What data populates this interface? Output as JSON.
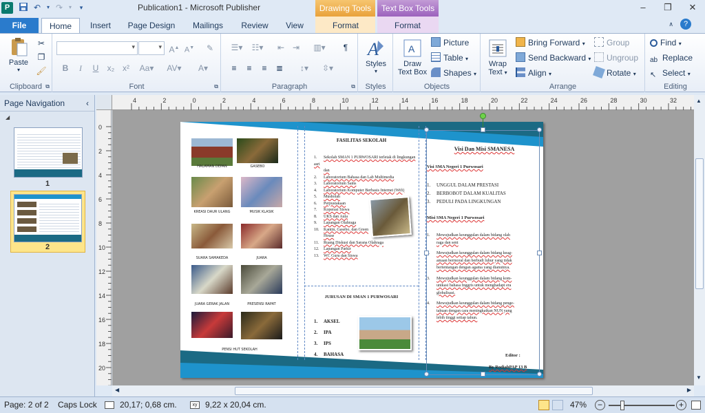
{
  "titlebar": {
    "app_icon": "P",
    "title": "Publication1 - Microsoft Publisher",
    "drawing_tools": "Drawing Tools",
    "text_box_tools": "Text Box Tools",
    "qat_icons": [
      "save-icon",
      "undo-icon",
      "redo-icon",
      "customize-icon"
    ],
    "window_buttons": [
      "minimize-icon",
      "restore-icon",
      "close-icon"
    ]
  },
  "tabs": {
    "file": "File",
    "home": "Home",
    "insert": "Insert",
    "page_design": "Page Design",
    "mailings": "Mailings",
    "review": "Review",
    "view": "View",
    "format_drawing": "Format",
    "format_textbox": "Format"
  },
  "ribbon": {
    "clipboard": {
      "label": "Clipboard",
      "paste": "Paste"
    },
    "font": {
      "label": "Font",
      "font_name": "",
      "font_size": ""
    },
    "paragraph": {
      "label": "Paragraph"
    },
    "styles": {
      "label": "Styles",
      "styles_btn": "Styles"
    },
    "objects": {
      "label": "Objects",
      "draw_text_box_1": "Draw",
      "draw_text_box_2": "Text Box",
      "picture": "Picture",
      "table": "Table",
      "shapes": "Shapes"
    },
    "arrange": {
      "label": "Arrange",
      "wrap_text_1": "Wrap",
      "wrap_text_2": "Text",
      "bring_forward": "Bring Forward",
      "send_backward": "Send Backward",
      "align": "Align",
      "group": "Group",
      "ungroup": "Ungroup",
      "rotate": "Rotate"
    },
    "editing": {
      "label": "Editing",
      "find": "Find",
      "replace": "Replace",
      "select": "Select"
    }
  },
  "nav": {
    "title": "Page Navigation",
    "pages": [
      {
        "num": "1"
      },
      {
        "num": "2",
        "selected": true
      }
    ]
  },
  "ruler": {
    "h_labels": [
      "4",
      "2",
      "0",
      "2",
      "4",
      "6",
      "8",
      "10",
      "12",
      "14",
      "16",
      "18",
      "20",
      "22",
      "24",
      "26",
      "28",
      "30",
      "32"
    ],
    "v_labels": [
      "0",
      "2",
      "4",
      "6",
      "8",
      "10",
      "12",
      "14",
      "16",
      "18",
      "20"
    ]
  },
  "page": {
    "captions": [
      "HALAMAN DEPAN",
      "GASEBO",
      "KREASI DAUR ULANG",
      "MUSIK KLASIK",
      "SUARA SAMAKEDA",
      "JUARA",
      "JUARA GERAK JALAN",
      "PRESENSI RAPAT",
      "",
      "PENSI HUT SEKOLAH"
    ],
    "col2": {
      "title": "FASILITAS SEKOLAH",
      "items": [
        {
          "n": "1.",
          "t": "Sekolah SMAN 1 PURWOSARI terletak di lingkungan asri"
        },
        {
          "n": "",
          "t": "dan"
        },
        {
          "n": "2.",
          "t": "Laboratorium Bahasa dan Lab Multimedia"
        },
        {
          "n": "3.",
          "t": "Laboratorium Sains"
        },
        {
          "n": "4.",
          "t": "Laboratorium Komputer Berbasis Internet (Wifi)"
        },
        {
          "n": "5.",
          "t": "Musholah"
        },
        {
          "n": "6.",
          "t": "Perpustakaan"
        },
        {
          "n": "7.",
          "t": "Koperasi Siswa"
        },
        {
          "n": "8.",
          "t": "UKS dan Aula"
        },
        {
          "n": "9.",
          "t": "Lapangan Olahraga"
        },
        {
          "n": "10.",
          "t": "Kantin, Gasebo, dan Green"
        },
        {
          "n": "",
          "t": "House"
        },
        {
          "n": "11.",
          "t": "Ruang Diskusi dan Sarana Olahraga"
        },
        {
          "n": "12.",
          "t": "Lapangan Parkir"
        },
        {
          "n": "13.",
          "t": "WC Guru dan Siswa"
        }
      ],
      "jurusan_title": "JURUSAN DI SMAN 1 PURWOSARI",
      "jurusan": [
        {
          "n": "1.",
          "t": "AKSEL"
        },
        {
          "n": "2.",
          "t": "IPA"
        },
        {
          "n": "3.",
          "t": "IPS"
        },
        {
          "n": "4.",
          "t": "BAHASA"
        }
      ]
    },
    "col3": {
      "title": "Visi Dan Misi SMANESA",
      "visi_head": "Visi SMA Negeri 1 Purwosari",
      "visi": [
        {
          "n": "1.",
          "t": "UNGGUL DALAM PRESTASI"
        },
        {
          "n": "2.",
          "t": "BERBOBOT DALAM KUALITAS"
        },
        {
          "n": "3.",
          "t": "PEDULI PADA LINGKUNGAN"
        }
      ],
      "misi_head": "Misi SMA Negeri 1 Purwosari",
      "misi": [
        {
          "n": "1.",
          "l1": "Mewujudkan keunggulan dalam bidang olah",
          "l2": "raga dan seni"
        },
        {
          "n": "2.",
          "l1": "Mewujudkan keunggulan dalam bidang keag-",
          "l2": "amaan bermoral dan berbudi luhur yang tidak",
          "l3": "bertentangan dengan agama yang dianutnya."
        },
        {
          "n": "3.",
          "l1": "Mewujudkan keunggulan dalam bidang kom-",
          "l2": "unikasi bahasa Inggris untuk menghadapi era",
          "l3": "globalisasi."
        },
        {
          "n": "4.",
          "l1": "Mewujudkan keunggulan dalam bidang penge-",
          "l2": "tahuan dengan cara meningkatkan NUN yang",
          "l3": "lebih tinggi setiap tahun."
        }
      ],
      "editor_label": "Editor :",
      "editor_name": "By RodiahPAP 13 B"
    }
  },
  "status": {
    "page": "Page: 2 of 2",
    "caps": "Caps Lock",
    "position": "20,17; 0,68 cm.",
    "size": "9,22 x  20,04 cm.",
    "zoom": "47%"
  },
  "colors": {
    "teal_band": "#1b6a84",
    "blue_band": "#1e93cc",
    "ribbon_tab": "#2a7bcc"
  }
}
